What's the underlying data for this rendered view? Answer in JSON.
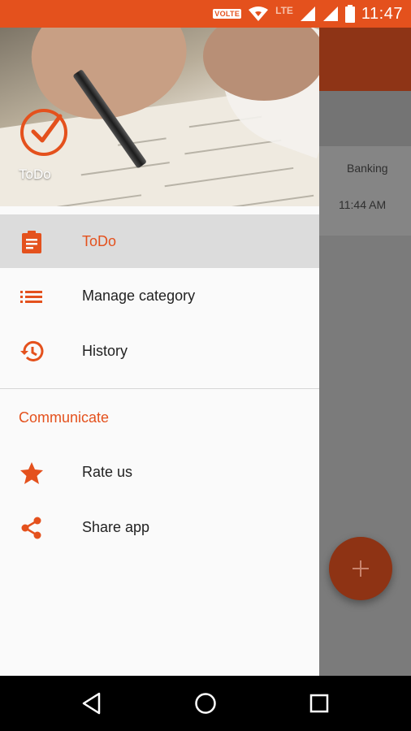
{
  "status_bar": {
    "volte": "VOLTE",
    "network": "LTE",
    "time": "11:47",
    "color": "#e4511d"
  },
  "background_app": {
    "category_tab": "Banking",
    "item_time": "11:44 AM",
    "fab_icon": "plus-icon"
  },
  "drawer": {
    "header": {
      "app_name": "ToDo",
      "logo_icon": "check-circle-icon"
    },
    "items": [
      {
        "label": "ToDo",
        "icon": "clipboard-icon",
        "active": true
      },
      {
        "label": "Manage category",
        "icon": "list-icon",
        "active": false
      },
      {
        "label": "History",
        "icon": "history-icon",
        "active": false
      }
    ],
    "section_title": "Communicate",
    "communicate_items": [
      {
        "label": "Rate us",
        "icon": "star-icon"
      },
      {
        "label": "Share app",
        "icon": "share-icon"
      }
    ],
    "accent_color": "#e4511d"
  },
  "nav_bar": {
    "back_icon": "back-triangle-icon",
    "home_icon": "home-circle-icon",
    "recents_icon": "recents-square-icon"
  }
}
